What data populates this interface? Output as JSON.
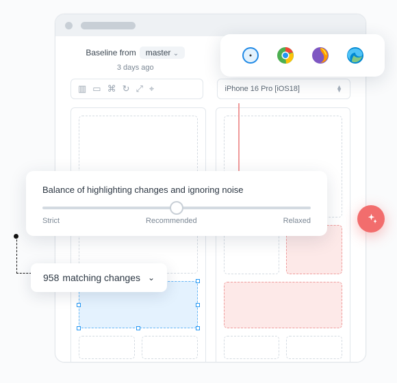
{
  "header": {
    "baseline_prefix": "Baseline from",
    "branch": "master",
    "ago": "3 days ago"
  },
  "toolbar_icons": [
    "layout-panel-icon",
    "device-icon",
    "attachment-icon",
    "refresh-icon",
    "tag-icon",
    "crosshair-icon"
  ],
  "device_select": {
    "value": "iPhone 16 Pro [iOS18]"
  },
  "balance": {
    "title": "Balance of highlighting changes and ignoring noise",
    "labels": {
      "left": "Strict",
      "mid": "Recommended",
      "right": "Relaxed"
    }
  },
  "matches": {
    "count": 958,
    "suffix": "matching changes"
  },
  "browsers": [
    "safari",
    "chrome",
    "firefox",
    "edge"
  ],
  "colors": {
    "accent_red": "#f26d6d",
    "highlight_red": "#ef9a9a",
    "highlight_blue": "#64b5f6"
  }
}
